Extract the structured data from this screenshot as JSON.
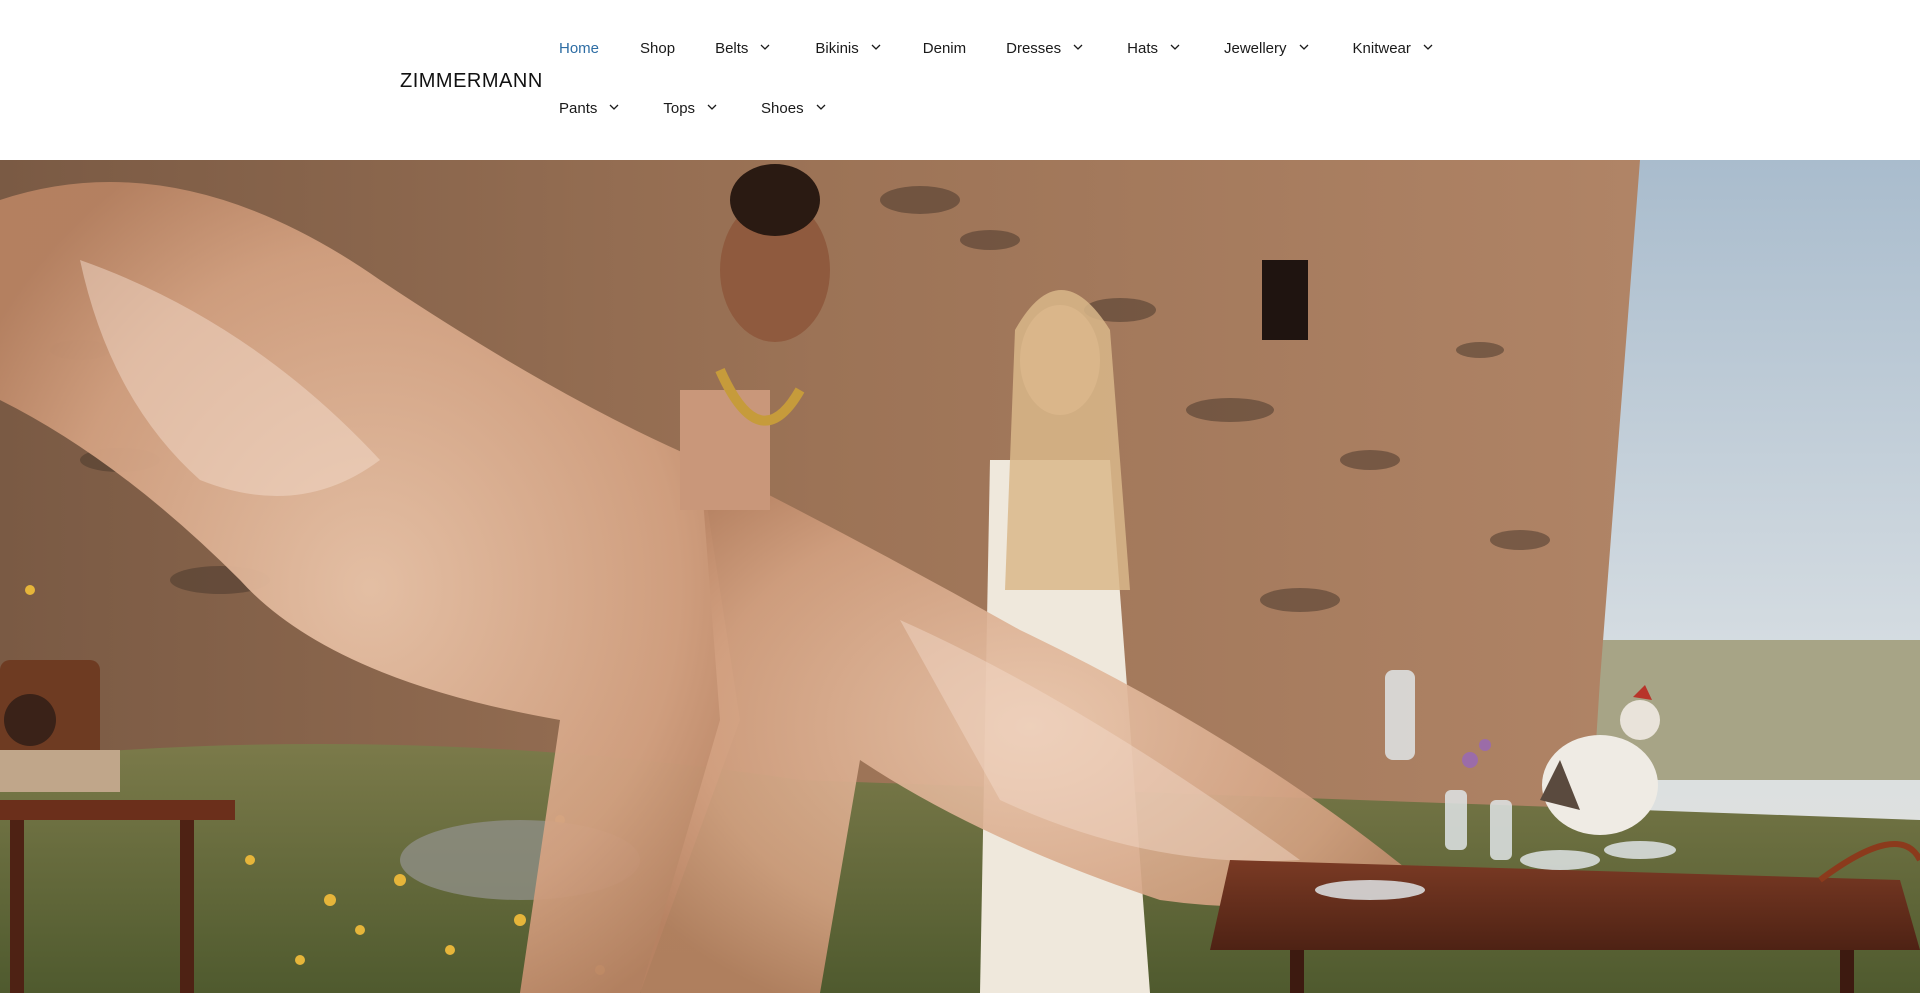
{
  "brand": {
    "logo_text": "ZIMMERMANN"
  },
  "nav": {
    "row1": [
      {
        "label": "Home",
        "active": true,
        "has_dropdown": false
      },
      {
        "label": "Shop",
        "active": false,
        "has_dropdown": false
      },
      {
        "label": "Belts",
        "active": false,
        "has_dropdown": true
      },
      {
        "label": "Bikinis",
        "active": false,
        "has_dropdown": true
      },
      {
        "label": "Denim",
        "active": false,
        "has_dropdown": false
      },
      {
        "label": "Dresses",
        "active": false,
        "has_dropdown": true
      },
      {
        "label": "Hats",
        "active": false,
        "has_dropdown": true
      },
      {
        "label": "Jewellery",
        "active": false,
        "has_dropdown": true
      },
      {
        "label": "Knitwear",
        "active": false,
        "has_dropdown": true
      }
    ],
    "row2": [
      {
        "label": "Pants",
        "active": false,
        "has_dropdown": true
      },
      {
        "label": "Tops",
        "active": false,
        "has_dropdown": true
      },
      {
        "label": "Shoes",
        "active": false,
        "has_dropdown": true
      }
    ]
  },
  "colors": {
    "active_link": "#2e6da4",
    "text": "#1a1a1a",
    "header_bg": "#ffffff"
  },
  "icons": {
    "dropdown": "chevron-down-icon"
  }
}
